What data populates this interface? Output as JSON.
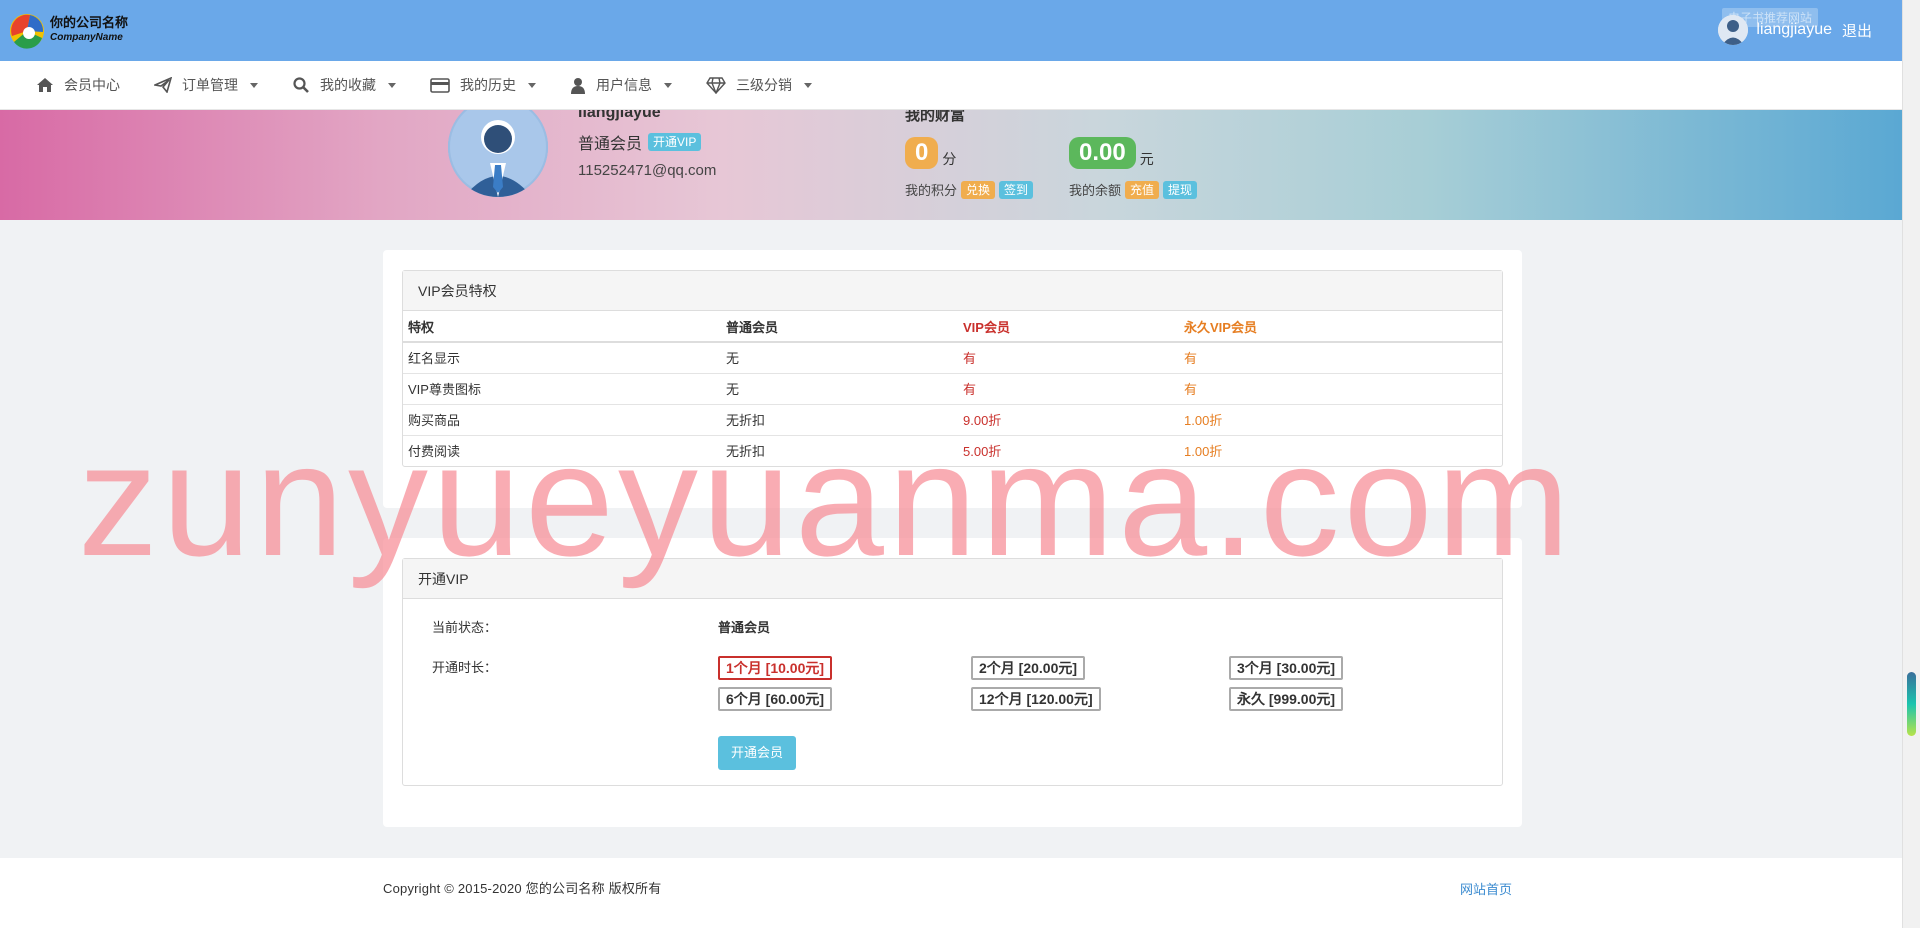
{
  "header": {
    "company_name": "你的公司名称",
    "company_sub": "CompanyName",
    "username": "liangjiayue",
    "logout": "退出",
    "tip": "电子书推荐网站"
  },
  "nav": [
    {
      "label": "会员中心",
      "icon": "home-icon",
      "dropdown": false
    },
    {
      "label": "订单管理",
      "icon": "paper-plane-icon",
      "dropdown": true
    },
    {
      "label": "我的收藏",
      "icon": "search-icon",
      "dropdown": true
    },
    {
      "label": "我的历史",
      "icon": "credit-card-icon",
      "dropdown": true
    },
    {
      "label": "用户信息",
      "icon": "user-icon",
      "dropdown": true
    },
    {
      "label": "三级分销",
      "icon": "diamond-icon",
      "dropdown": true
    }
  ],
  "profile": {
    "username": "liangjiayue",
    "member_level": "普通会员",
    "open_vip": "开通VIP",
    "email": "115252471@qq.com",
    "assets_title": "我的财富",
    "points_value": "0",
    "points_unit": "分",
    "points_label": "我的积分",
    "exchange": "兑换",
    "checkin": "签到",
    "balance_value": "0.00",
    "balance_unit": "元",
    "balance_label": "我的余额",
    "recharge": "充值",
    "withdraw": "提现"
  },
  "privileges": {
    "title": "VIP会员特权",
    "headers": [
      "特权",
      "普通会员",
      "VIP会员",
      "永久VIP会员"
    ],
    "rows": [
      [
        "红名显示",
        "无",
        "有",
        "有"
      ],
      [
        "VIP尊贵图标",
        "无",
        "有",
        "有"
      ],
      [
        "购买商品",
        "无折扣",
        "9.00折",
        "1.00折"
      ],
      [
        "付费阅读",
        "无折扣",
        "5.00折",
        "1.00折"
      ]
    ]
  },
  "open_vip": {
    "title": "开通VIP",
    "status_label": "当前状态：",
    "status_value": "普通会员",
    "duration_label": "开通时长：",
    "options": [
      "1个月 [10.00元]",
      "2个月 [20.00元]",
      "3个月 [30.00元]",
      "6个月 [60.00元]",
      "12个月 [120.00元]",
      "永久 [999.00元]"
    ],
    "selected_index": 0,
    "submit": "开通会员"
  },
  "footer": {
    "copyright": "Copyright © 2015-2020 您的公司名称 版权所有",
    "home_link": "网站首页"
  },
  "watermark": "zunyueyuanma.com",
  "colors": {
    "topbar": "#6aa8e9",
    "accent_blue": "#5bc0de",
    "vip_red": "#c9302c",
    "vip_orange": "#e67e22"
  }
}
